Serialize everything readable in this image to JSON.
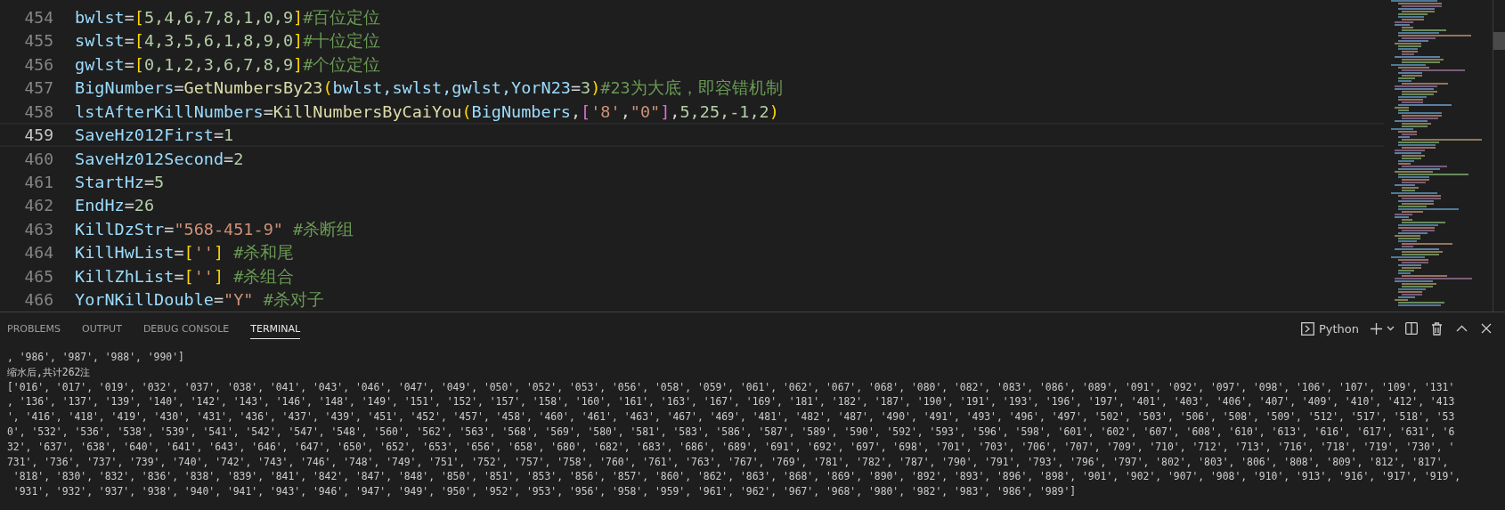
{
  "editor": {
    "lines": [
      {
        "number": "454",
        "current": false,
        "tokens": [
          {
            "kind": "ident",
            "text": "bwlst"
          },
          {
            "kind": "op",
            "text": "="
          },
          {
            "kind": "bracket",
            "text": "["
          },
          {
            "kind": "num",
            "text": "5,4,6,7,8,1,0,9"
          },
          {
            "kind": "bracket",
            "text": "]"
          },
          {
            "kind": "comment",
            "text": "#百位定位"
          }
        ]
      },
      {
        "number": "455",
        "current": false,
        "tokens": [
          {
            "kind": "ident",
            "text": "swlst"
          },
          {
            "kind": "op",
            "text": "="
          },
          {
            "kind": "bracket",
            "text": "["
          },
          {
            "kind": "num",
            "text": "4,3,5,6,1,8,9,0"
          },
          {
            "kind": "bracket",
            "text": "]"
          },
          {
            "kind": "comment",
            "text": "#十位定位"
          }
        ]
      },
      {
        "number": "456",
        "current": false,
        "tokens": [
          {
            "kind": "ident",
            "text": "gwlst"
          },
          {
            "kind": "op",
            "text": "="
          },
          {
            "kind": "bracket",
            "text": "["
          },
          {
            "kind": "num",
            "text": "0,1,2,3,6,7,8,9"
          },
          {
            "kind": "bracket",
            "text": "]"
          },
          {
            "kind": "comment",
            "text": "#个位定位"
          }
        ]
      },
      {
        "number": "457",
        "current": false,
        "tokens": [
          {
            "kind": "ident",
            "text": "BigNumbers"
          },
          {
            "kind": "op",
            "text": "="
          },
          {
            "kind": "func",
            "text": "GetNumbersBy23"
          },
          {
            "kind": "bracket",
            "text": "("
          },
          {
            "kind": "ident",
            "text": "bwlst,swlst,gwlst,YorN23"
          },
          {
            "kind": "op",
            "text": "="
          },
          {
            "kind": "num",
            "text": "3"
          },
          {
            "kind": "bracket",
            "text": ")"
          },
          {
            "kind": "comment",
            "text": "#23为大底，即容错机制"
          }
        ]
      },
      {
        "number": "458",
        "current": false,
        "tokens": [
          {
            "kind": "ident",
            "text": "lstAfterKillNumbers"
          },
          {
            "kind": "op",
            "text": "="
          },
          {
            "kind": "func",
            "text": "KillNumbersByCaiYou"
          },
          {
            "kind": "bracket",
            "text": "("
          },
          {
            "kind": "ident",
            "text": "BigNumbers"
          },
          {
            "kind": "op",
            "text": ","
          },
          {
            "kind": "bracket2",
            "text": "["
          },
          {
            "kind": "str",
            "text": "'8'"
          },
          {
            "kind": "op",
            "text": ","
          },
          {
            "kind": "str",
            "text": "\"0\""
          },
          {
            "kind": "bracket2",
            "text": "]"
          },
          {
            "kind": "op",
            "text": ","
          },
          {
            "kind": "num",
            "text": "5,25,-1,2"
          },
          {
            "kind": "bracket",
            "text": ")"
          }
        ]
      },
      {
        "number": "459",
        "current": true,
        "tokens": [
          {
            "kind": "ident",
            "text": "SaveHz012First"
          },
          {
            "kind": "op",
            "text": "="
          },
          {
            "kind": "num",
            "text": "1"
          }
        ]
      },
      {
        "number": "460",
        "current": false,
        "tokens": [
          {
            "kind": "ident",
            "text": "SaveHz012Second"
          },
          {
            "kind": "op",
            "text": "="
          },
          {
            "kind": "num",
            "text": "2"
          }
        ]
      },
      {
        "number": "461",
        "current": false,
        "tokens": [
          {
            "kind": "ident",
            "text": "StartHz"
          },
          {
            "kind": "op",
            "text": "="
          },
          {
            "kind": "num",
            "text": "5"
          }
        ]
      },
      {
        "number": "462",
        "current": false,
        "tokens": [
          {
            "kind": "ident",
            "text": "EndHz"
          },
          {
            "kind": "op",
            "text": "="
          },
          {
            "kind": "num",
            "text": "26"
          }
        ]
      },
      {
        "number": "463",
        "current": false,
        "tokens": [
          {
            "kind": "ident",
            "text": "KillDzStr"
          },
          {
            "kind": "op",
            "text": "="
          },
          {
            "kind": "str",
            "text": "\"568-451-9\""
          },
          {
            "kind": "comment",
            "text": " #杀断组"
          }
        ]
      },
      {
        "number": "464",
        "current": false,
        "tokens": [
          {
            "kind": "ident",
            "text": "KillHwList"
          },
          {
            "kind": "op",
            "text": "="
          },
          {
            "kind": "bracket",
            "text": "["
          },
          {
            "kind": "str",
            "text": "''"
          },
          {
            "kind": "bracket",
            "text": "]"
          },
          {
            "kind": "comment",
            "text": " #杀和尾"
          }
        ]
      },
      {
        "number": "465",
        "current": false,
        "tokens": [
          {
            "kind": "ident",
            "text": "KillZhList"
          },
          {
            "kind": "op",
            "text": "="
          },
          {
            "kind": "bracket",
            "text": "["
          },
          {
            "kind": "str",
            "text": "''"
          },
          {
            "kind": "bracket",
            "text": "]"
          },
          {
            "kind": "comment",
            "text": " #杀组合"
          }
        ]
      },
      {
        "number": "466",
        "current": false,
        "tokens": [
          {
            "kind": "ident",
            "text": "YorNKillDouble"
          },
          {
            "kind": "op",
            "text": "="
          },
          {
            "kind": "str",
            "text": "\"Y\""
          },
          {
            "kind": "comment",
            "text": " #杀对子"
          }
        ]
      }
    ]
  },
  "panel": {
    "tabs": [
      {
        "label": "PROBLEMS",
        "selected": false
      },
      {
        "label": "OUTPUT",
        "selected": false
      },
      {
        "label": "DEBUG CONSOLE",
        "selected": false
      },
      {
        "label": "TERMINAL",
        "selected": true
      }
    ],
    "terminal_name": "Python",
    "terminal_lines": [
      ", '986', '987', '988', '990']",
      "缩水后,共计262注",
      "['016', '017', '019', '032', '037', '038', '041', '043', '046', '047', '049', '050', '052', '053', '056', '058', '059', '061', '062', '067', '068', '080', '082', '083', '086', '089', '091', '092', '097', '098', '106', '107', '109', '131'",
      ", '136', '137', '139', '140', '142', '143', '146', '148', '149', '151', '152', '157', '158', '160', '161', '163', '167', '169', '181', '182', '187', '190', '191', '193', '196', '197', '401', '403', '406', '407', '409', '410', '412', '413",
      "', '416', '418', '419', '430', '431', '436', '437', '439', '451', '452', '457', '458', '460', '461', '463', '467', '469', '481', '482', '487', '490', '491', '493', '496', '497', '502', '503', '506', '508', '509', '512', '517', '518', '53",
      "0', '532', '536', '538', '539', '541', '542', '547', '548', '560', '562', '563', '568', '569', '580', '581', '583', '586', '587', '589', '590', '592', '593', '596', '598', '601', '602', '607', '608', '610', '613', '616', '617', '631', '6",
      "32', '637', '638', '640', '641', '643', '646', '647', '650', '652', '653', '656', '658', '680', '682', '683', '686', '689', '691', '692', '697', '698', '701', '703', '706', '707', '709', '710', '712', '713', '716', '718', '719', '730', '",
      "731', '736', '737', '739', '740', '742', '743', '746', '748', '749', '751', '752', '757', '758', '760', '761', '763', '767', '769', '781', '782', '787', '790', '791', '793', '796', '797', '802', '803', '806', '808', '809', '812', '817',",
      " '818', '830', '832', '836', '838', '839', '841', '842', '847', '848', '850', '851', '853', '856', '857', '860', '862', '863', '868', '869', '890', '892', '893', '896', '898', '901', '902', '907', '908', '910', '913', '916', '917', '919',",
      " '931', '932', '937', '938', '940', '941', '943', '946', '947', '949', '950', '952', '953', '956', '958', '959', '961', '962', '967', '968', '980', '982', '983', '986', '989']"
    ]
  }
}
